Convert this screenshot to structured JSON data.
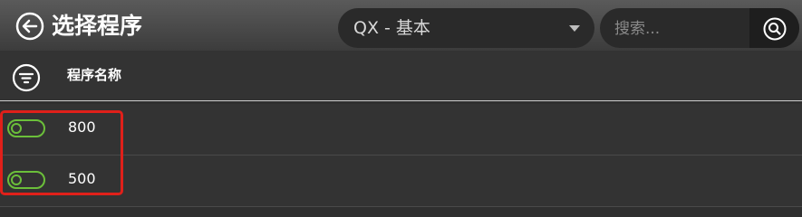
{
  "header": {
    "title": "选择程序",
    "dropdown_value": "QX - 基本",
    "search_placeholder": "搜索..."
  },
  "table": {
    "column_label": "程序名称",
    "rows": [
      {
        "name": "800",
        "toggle_on": false
      },
      {
        "name": "500",
        "toggle_on": false
      }
    ]
  },
  "colors": {
    "toggle_accent": "#6bbf3a",
    "highlight_border": "#e0201a",
    "header_bg": "#4a4a4a",
    "body_bg": "#333333"
  },
  "icons": {
    "back": "back-arrow-circle-icon",
    "search": "search-icon",
    "filter": "filter-icon",
    "dropdown": "caret-down-icon"
  }
}
